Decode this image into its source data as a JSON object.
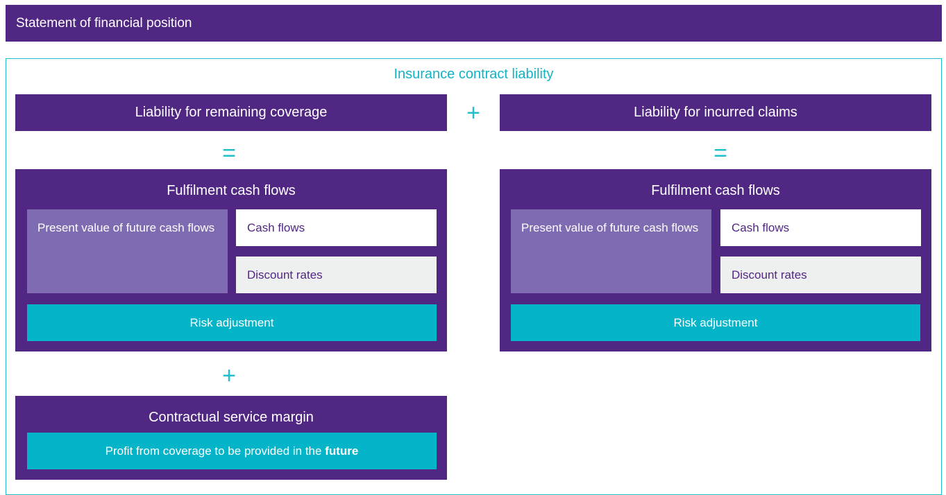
{
  "title_bar": "Statement of financial position",
  "outer_label": "Insurance contract liability",
  "left": {
    "header": "Liability for remaining coverage",
    "fcf": {
      "title": "Fulfilment cash flows",
      "pv": "Present value of future cash flows",
      "cash_flows": "Cash flows",
      "discount_rates": "Discount rates",
      "risk": "Risk adjustment"
    },
    "csm": {
      "title": "Contractual service margin",
      "row_text": "Profit from coverage to be provided in the ",
      "row_bold": "future"
    }
  },
  "right": {
    "header": "Liability for incurred claims",
    "fcf": {
      "title": "Fulfilment cash flows",
      "pv": "Present value of future cash flows",
      "cash_flows": "Cash flows",
      "discount_rates": "Discount rates",
      "risk": "Risk adjustment"
    }
  },
  "operators": {
    "plus": "+",
    "equals": "="
  },
  "colors": {
    "purple": "#512784",
    "light_purple": "#7e6bb1",
    "teal": "#04b4c9",
    "grey": "#edf0ee"
  }
}
